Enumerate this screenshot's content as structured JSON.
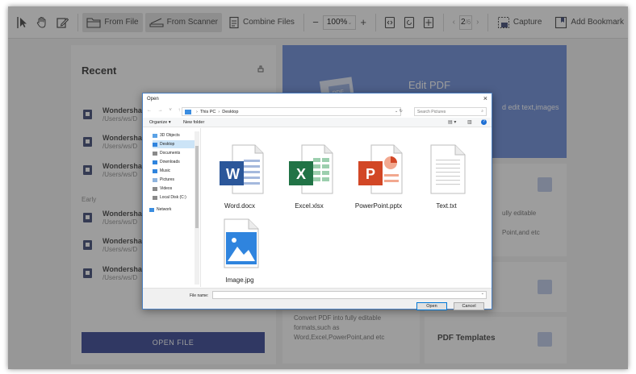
{
  "toolbar": {
    "from_file": "From File",
    "from_scanner": "From Scanner",
    "combine_files": "Combine Files",
    "zoom_minus": "−",
    "zoom_value": "100%",
    "zoom_plus": "+",
    "page_current": "2",
    "page_total": "/6",
    "capture": "Capture",
    "add_bookmark": "Add Bookmark"
  },
  "recent": {
    "title": "Recent",
    "early_label": "Early",
    "items": [
      {
        "name": "Wondershar",
        "path": "/Users/ws/D"
      },
      {
        "name": "Wondershar",
        "path": "/Users/ws/D"
      },
      {
        "name": "Wondershar",
        "path": "/Users/ws/D"
      },
      {
        "name": "Wondershar",
        "path": "/Users/ws/D"
      },
      {
        "name": "Wondershar",
        "path": "/Users/ws/D"
      },
      {
        "name": "Wondershar",
        "path": "/Users/ws/D"
      }
    ],
    "open_file": "OPEN FILE"
  },
  "cards": {
    "edit_title": "Edit PDF",
    "edit_desc": "d edit text,images",
    "convert_desc_right_1": "ully editable",
    "convert_desc_right_2": "Point,and etc",
    "convert_desc": "Convert PDF into fully editable formats,such as Word,Excel,PowerPoint,and etc",
    "templates_title": "PDF Templates",
    "pdf_badge": "PDF"
  },
  "dialog": {
    "title": "Open",
    "close": "×",
    "path_root": "This PC",
    "path_leaf": "Desktop",
    "search_placeholder": "Search Pictures",
    "organize": "Organize ▾",
    "new_folder": "New folder",
    "nav": [
      {
        "label": "3D Objects",
        "color": "#5aa2e6"
      },
      {
        "label": "Desktop",
        "color": "#2f84de"
      },
      {
        "label": "Documents",
        "color": "#8a8a8a"
      },
      {
        "label": "Downloads",
        "color": "#2f84de"
      },
      {
        "label": "Music",
        "color": "#2f84de"
      },
      {
        "label": "Pictures",
        "color": "#8fb4de"
      },
      {
        "label": "Videos",
        "color": "#8a8a8a"
      },
      {
        "label": "Local Disk (C:)",
        "color": "#8a8a8a"
      },
      {
        "label": "Network",
        "color": "#3b8de0"
      }
    ],
    "files": [
      {
        "name": "Word.docx",
        "letter": "W",
        "color": "#2b579a"
      },
      {
        "name": "Excel.xlsx",
        "letter": "X",
        "color": "#217346"
      },
      {
        "name": "PowerPoint.pptx",
        "letter": "P",
        "color": "#d24726"
      },
      {
        "name": "Text.txt",
        "letter": "",
        "color": "#ffffff"
      },
      {
        "name": "Image.jpg",
        "letter": "",
        "color": "#2f84de"
      }
    ],
    "file_name_label": "File name:",
    "open_btn": "Open",
    "cancel_btn": "Cancel"
  }
}
